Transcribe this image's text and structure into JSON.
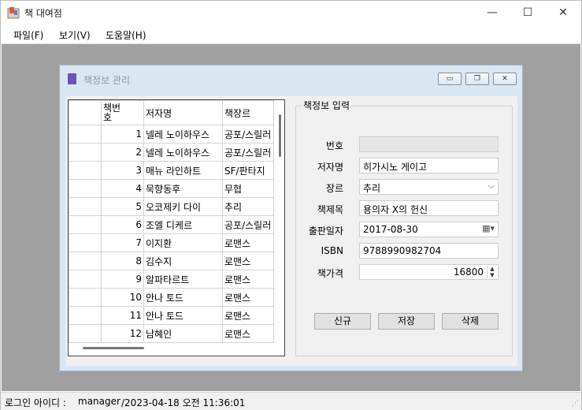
{
  "window": {
    "title": "책 대여점",
    "minimize": "—",
    "maximize": "☐",
    "close": "✕"
  },
  "menu": [
    {
      "label": "파일(F)"
    },
    {
      "label": "보기(V)"
    },
    {
      "label": "도움말(H)"
    }
  ],
  "child": {
    "title": "책정보 관리"
  },
  "grid": {
    "headers": [
      "책번\n호",
      "저자명",
      "책장르"
    ],
    "rows": [
      {
        "no": "1",
        "author": "넬레 노이하우스",
        "genre": "공포/스릴러"
      },
      {
        "no": "2",
        "author": "넬레 노이하우스",
        "genre": "공포/스릴러"
      },
      {
        "no": "3",
        "author": "매뉴 라인하트",
        "genre": "SF/판타지"
      },
      {
        "no": "4",
        "author": "묵향동후",
        "genre": "무협"
      },
      {
        "no": "5",
        "author": "오코제키 다이",
        "genre": "추리"
      },
      {
        "no": "6",
        "author": "조엘 디케르",
        "genre": "공포/스릴러"
      },
      {
        "no": "7",
        "author": "이지환",
        "genre": "로맨스"
      },
      {
        "no": "8",
        "author": "김수지",
        "genre": "로맨스"
      },
      {
        "no": "9",
        "author": "알파타르트",
        "genre": "로맨스"
      },
      {
        "no": "10",
        "author": "안나 토드",
        "genre": "로맨스"
      },
      {
        "no": "11",
        "author": "안나 토드",
        "genre": "로맨스"
      },
      {
        "no": "12",
        "author": "남혜인",
        "genre": "로맨스"
      }
    ]
  },
  "form": {
    "group_title": "책정보 입력",
    "labels": {
      "no": "번호",
      "author": "저자명",
      "genre": "장르",
      "title": "책제목",
      "pubdate": "출판일자",
      "isbn": "ISBN",
      "price": "책가격"
    },
    "values": {
      "no": "",
      "author": "히가시노 게이고",
      "genre": "추리",
      "title": "용의자 X의 헌신",
      "pubdate": "2017-08-30",
      "isbn": "9788990982704",
      "price": "16800"
    },
    "buttons": {
      "new": "신규",
      "save": "저장",
      "delete": "삭제"
    }
  },
  "status": {
    "label": "로그인 아이디 :",
    "user": "manager",
    "time": "/2023-04-18 오전 11:36:01"
  }
}
